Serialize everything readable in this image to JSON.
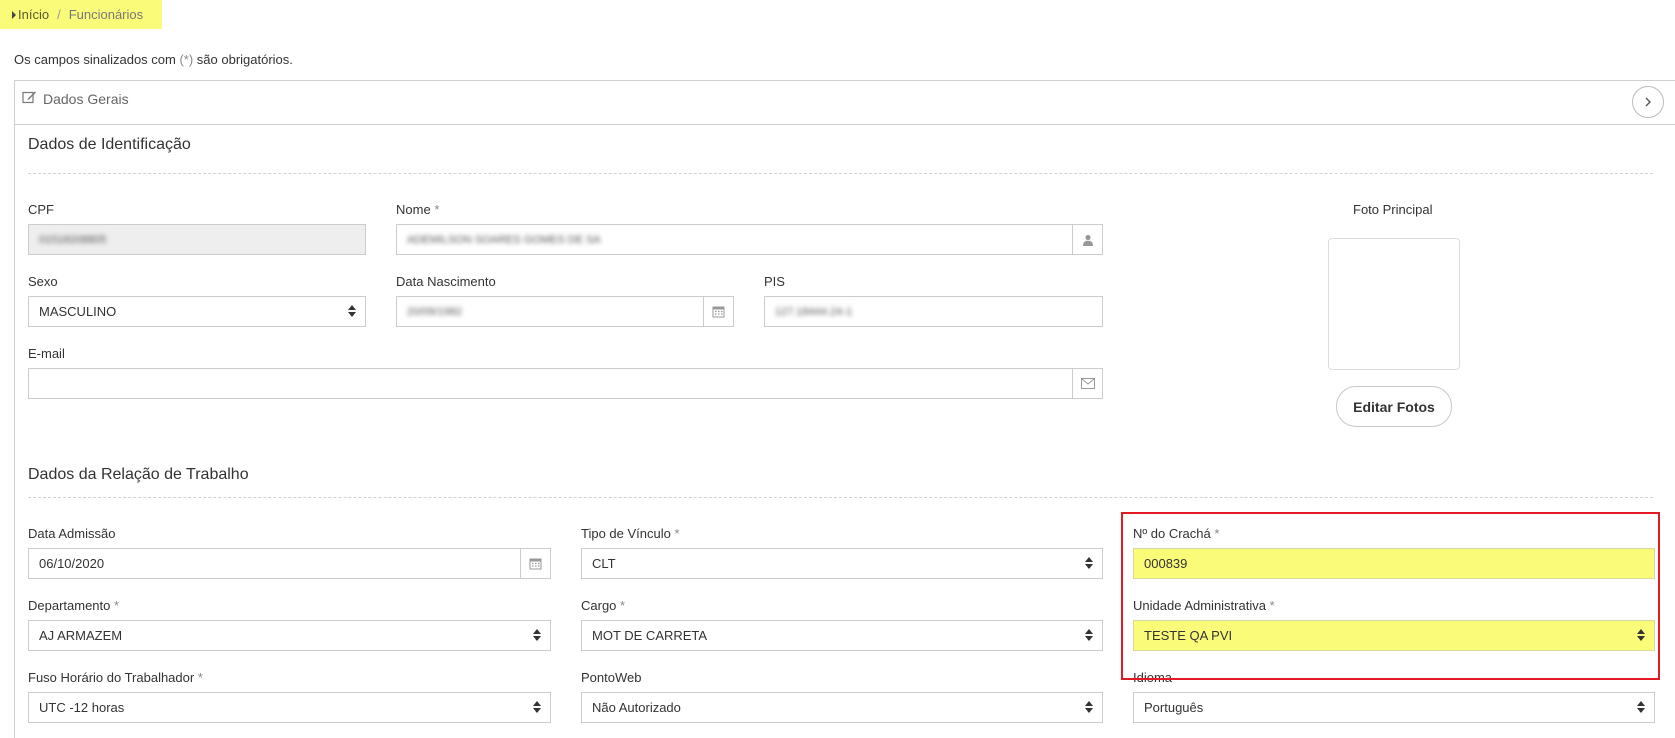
{
  "breadcrumb": {
    "home": "Início",
    "separator": "/",
    "current": "Funcionários"
  },
  "required_note": {
    "prefix": "Os campos sinalizados com ",
    "marker": "(*)",
    "suffix": " são obrigatórios."
  },
  "panel": {
    "title": "Dados Gerais",
    "icon": "edit-icon",
    "toggle_icon": "chevron-right-icon"
  },
  "identification": {
    "title": "Dados de Identificação",
    "cpf": {
      "label": "CPF",
      "value": "01518208805"
    },
    "nome": {
      "label": "Nome",
      "required": "*",
      "value": "ADEMILSON SOARES GOMES DE SA",
      "icon": "user-icon"
    },
    "sexo": {
      "label": "Sexo",
      "value": "MASCULINO"
    },
    "data_nascimento": {
      "label": "Data Nascimento",
      "value": "20/09/1982",
      "icon": "calendar-icon"
    },
    "pis": {
      "label": "PIS",
      "value": "127.18444.24-1"
    },
    "email": {
      "label": "E-mail",
      "value": "",
      "icon": "envelope-icon"
    },
    "photo": {
      "label": "Foto Principal",
      "button": "Editar Fotos"
    }
  },
  "work_relation": {
    "title": "Dados da Relação de Trabalho",
    "data_admissao": {
      "label": "Data Admissão",
      "value": "06/10/2020",
      "icon": "calendar-icon"
    },
    "tipo_vinculo": {
      "label": "Tipo de Vínculo",
      "required": "*",
      "value": "CLT"
    },
    "cracha": {
      "label": "Nº do Crachá",
      "required": "*",
      "value": "000839"
    },
    "departamento": {
      "label": "Departamento",
      "required": "*",
      "value": "AJ ARMAZEM"
    },
    "cargo": {
      "label": "Cargo",
      "required": "*",
      "value": "MOT DE CARRETA"
    },
    "unidade": {
      "label": "Unidade Administrativa",
      "required": "*",
      "value": "TESTE QA PVI"
    },
    "fuso": {
      "label": "Fuso Horário do Trabalhador",
      "required": "*",
      "value": "UTC -12 horas"
    },
    "pontoweb": {
      "label": "PontoWeb",
      "value": "Não Autorizado"
    },
    "idioma": {
      "label": "Idioma",
      "value": "Português"
    }
  },
  "colors": {
    "highlight": "#fbfb7a",
    "annotation_border": "#e01b24",
    "disabled_bg": "#eeeeee",
    "border": "#cccccc"
  }
}
